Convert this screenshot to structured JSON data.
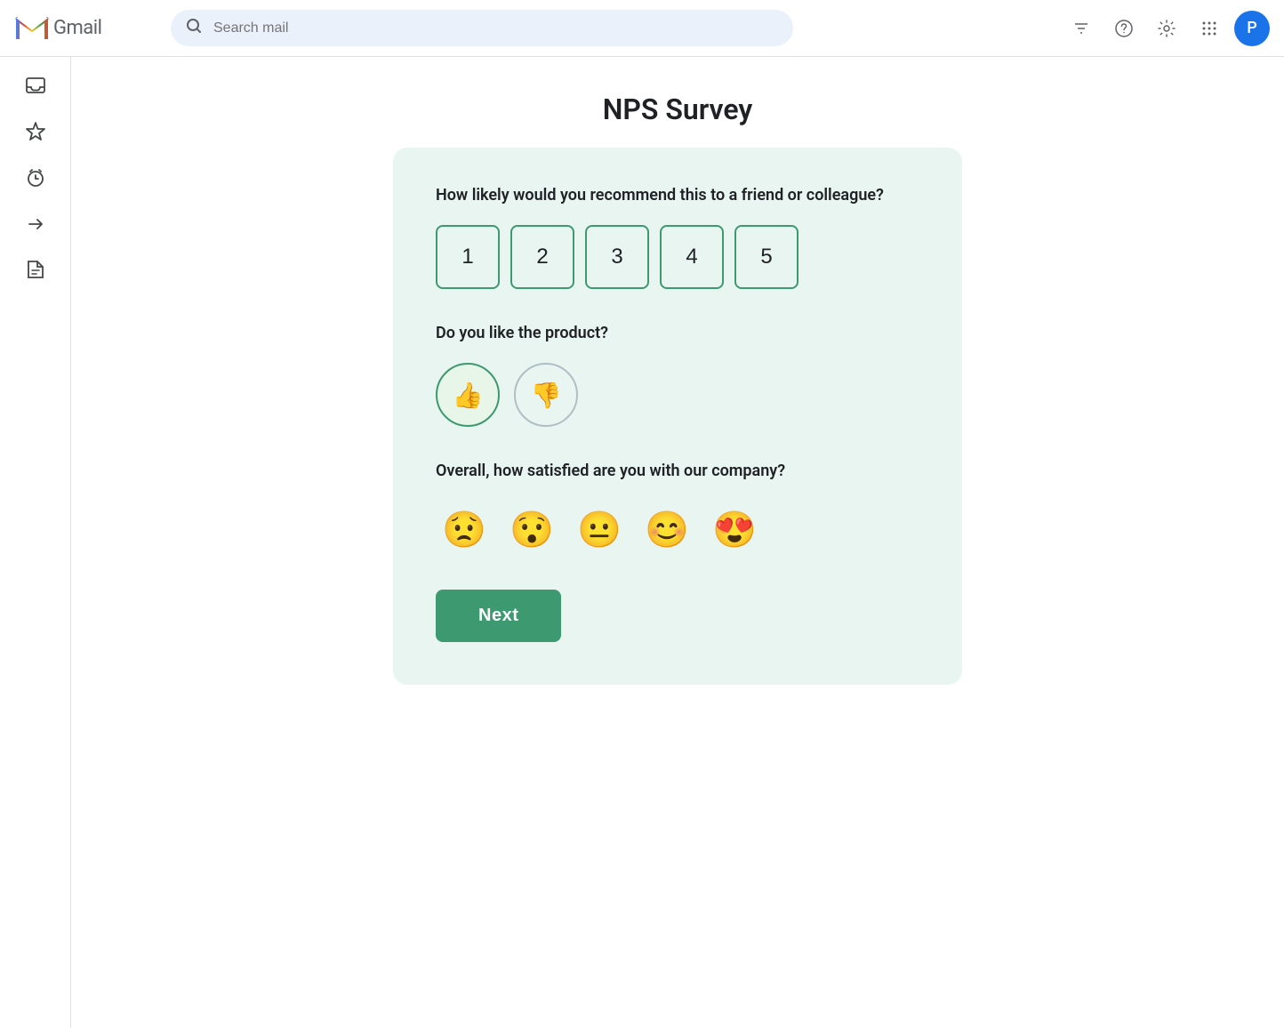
{
  "header": {
    "logo_text": "Gmail",
    "search_placeholder": "Search mail",
    "avatar_letter": "P"
  },
  "sidebar": {
    "icons": [
      {
        "name": "inbox-icon",
        "symbol": "⊡"
      },
      {
        "name": "starred-icon",
        "symbol": "☆"
      },
      {
        "name": "snoozed-icon",
        "symbol": "🕐"
      },
      {
        "name": "sent-icon",
        "symbol": "➤"
      },
      {
        "name": "drafts-icon",
        "symbol": "📄"
      }
    ]
  },
  "survey": {
    "title": "NPS Survey",
    "q1_label": "How likely would you recommend this to a friend or colleague?",
    "rating_options": [
      "1",
      "2",
      "3",
      "4",
      "5"
    ],
    "q2_label": "Do you like the product?",
    "thumbs": {
      "up": "👍",
      "down": "👎"
    },
    "q3_label": "Overall, how satisfied are you with our company?",
    "emojis": [
      "😟",
      "😯",
      "😐",
      "😊",
      "😍"
    ],
    "next_label": "Next"
  },
  "icons": {
    "search": "🔍",
    "settings_filter": "⚙",
    "help": "?",
    "settings": "⚙",
    "apps": "⠿"
  }
}
